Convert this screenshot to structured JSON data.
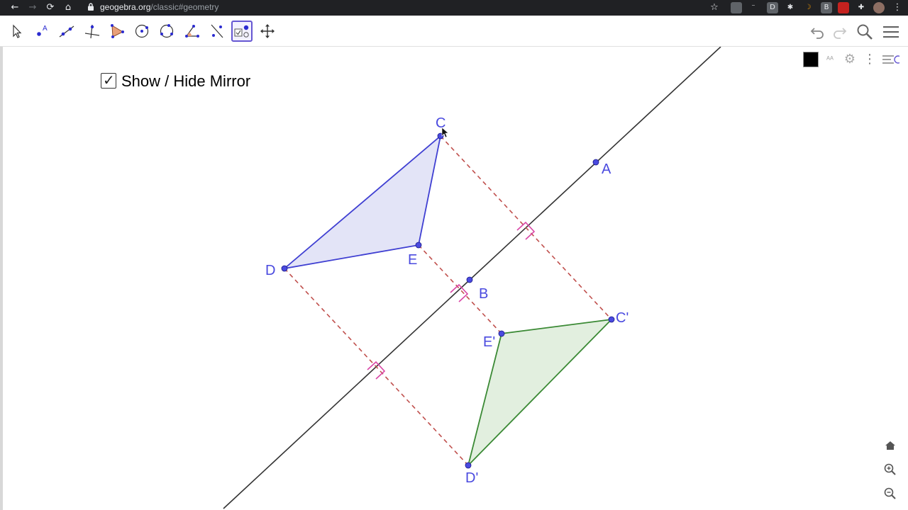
{
  "browser": {
    "url_domain": "geogebra.org",
    "url_path": "/classic#geometry",
    "back_label": "←",
    "forward_label": "→",
    "reload_label": "⟳",
    "home_label": "⌂",
    "star_label": "☆"
  },
  "toolbar": {
    "tools": [
      {
        "name": "move-tool"
      },
      {
        "name": "point-tool"
      },
      {
        "name": "line-tool"
      },
      {
        "name": "perpendicular-line-tool"
      },
      {
        "name": "polygon-tool"
      },
      {
        "name": "circle-center-point-tool"
      },
      {
        "name": "circle-three-points-tool"
      },
      {
        "name": "angle-tool"
      },
      {
        "name": "reflect-about-line-tool"
      },
      {
        "name": "checkbox-tool",
        "active": true
      },
      {
        "name": "move-graphics-view-tool"
      }
    ],
    "right": [
      "undo-icon",
      "redo-icon",
      "search-icon",
      "menu-icon"
    ]
  },
  "style_bar": {
    "color": "#000000",
    "items": [
      "color-swatch",
      "text-size-icon",
      "gear-icon",
      "more-vert-icon",
      "algebra-view-toggle-icon"
    ]
  },
  "checkbox": {
    "label": "Show / Hide Mirror",
    "checked": true,
    "check_glyph": "✓"
  },
  "geometry": {
    "points": {
      "A": {
        "label": "A"
      },
      "B": {
        "label": "B"
      },
      "C": {
        "label": "C"
      },
      "D": {
        "label": "D"
      },
      "E": {
        "label": "E"
      },
      "C'": {
        "label": "C'"
      },
      "D'": {
        "label": "D'"
      },
      "E'": {
        "label": "E'"
      }
    },
    "colors": {
      "point": "#4a4adf",
      "original_fill": "#e3e4f7",
      "original_stroke": "#3f3fd2",
      "image_fill": "#e2efdf",
      "image_stroke": "#3b8a35",
      "mirror_line": "#333333",
      "dashed": "#c0504d",
      "right_angle": "#d946a6"
    }
  },
  "zoom_controls": [
    "home-icon",
    "zoom-in-icon",
    "zoom-out-icon"
  ]
}
